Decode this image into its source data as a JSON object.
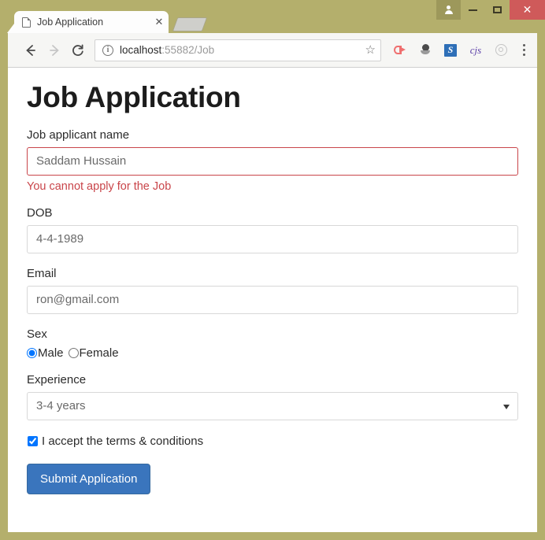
{
  "window": {
    "frame_color": "#b4af6c",
    "controls": {
      "avatar_label": "",
      "minimize_label": "",
      "maximize_label": "",
      "close_label": "✕"
    }
  },
  "browser": {
    "tab": {
      "title": "Job Application",
      "close_label": "✕",
      "favicon": "page-icon"
    },
    "new_tab_label": "",
    "nav": {
      "back_label": "←",
      "forward_label": "→",
      "reload_label": "⟳"
    },
    "address_bar": {
      "info_icon": "info-icon",
      "url_host": "localhost",
      "url_rest": ":55882/Job",
      "bookmark_label": "☆"
    },
    "extensions": [
      {
        "name": "red-arrow-extension-icon",
        "label": ""
      },
      {
        "name": "ink-drop-extension-icon",
        "label": ""
      },
      {
        "name": "blue-s-extension-icon",
        "label": "S"
      },
      {
        "name": "cjs-extension-icon",
        "label": "cjs"
      },
      {
        "name": "gray-circle-extension-icon",
        "label": ""
      }
    ],
    "menu_label": ""
  },
  "page": {
    "title": "Job Application",
    "fields": {
      "name": {
        "label": "Job applicant name",
        "value": "Saddam Hussain",
        "error": "You cannot apply for the Job",
        "invalid": true
      },
      "dob": {
        "label": "DOB",
        "value": "4-4-1989"
      },
      "email": {
        "label": "Email",
        "value": "ron@gmail.com"
      },
      "sex": {
        "label": "Sex",
        "options": [
          {
            "label": "Male",
            "selected": true
          },
          {
            "label": "Female",
            "selected": false
          }
        ]
      },
      "experience": {
        "label": "Experience",
        "value": "3-4 years"
      },
      "terms": {
        "label": "I accept the terms & conditions",
        "checked": true
      }
    },
    "submit_label": "Submit Application",
    "accent_color": "#3a75bd",
    "error_color": "#c9454a"
  }
}
